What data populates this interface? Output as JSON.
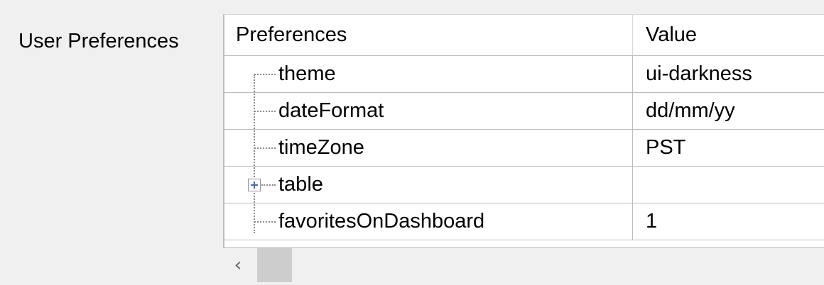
{
  "section": {
    "label": "User Preferences"
  },
  "grid": {
    "columns": {
      "preferences": "Preferences",
      "value": "Value"
    },
    "rows": [
      {
        "name": "theme",
        "value": "ui-darkness",
        "expandable": false
      },
      {
        "name": "dateFormat",
        "value": "dd/mm/yy",
        "expandable": false
      },
      {
        "name": "timeZone",
        "value": "PST",
        "expandable": false
      },
      {
        "name": "table",
        "value": "",
        "expandable": true
      },
      {
        "name": "favoritesOnDashboard",
        "value": "1",
        "expandable": false
      }
    ]
  },
  "scrollbar": {
    "left_icon": "chevron-left-icon",
    "left_glyph": "‹"
  },
  "colors": {
    "background": "#f0f0f0",
    "grid_background": "#ffffff",
    "border": "#bcbcbc",
    "tree_line": "#8a8a8a",
    "scroll_thumb": "#cdcdcd"
  }
}
